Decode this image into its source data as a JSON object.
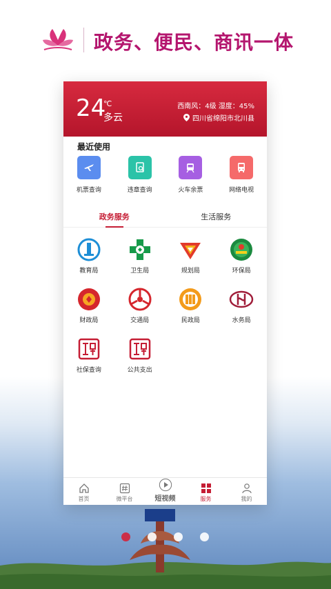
{
  "banner": {
    "slogan": "政务、便民、商讯一体"
  },
  "weather": {
    "temperature": "24",
    "unit": "℃",
    "condition": "多云",
    "wind_humidity": "西南风：4级  湿度：45%",
    "location": "四川省绵阳市北川县"
  },
  "recent": {
    "title": "最近使用",
    "items": [
      {
        "label": "机票查询",
        "icon": "airplane-icon",
        "color": "#5b8def"
      },
      {
        "label": "违章查询",
        "icon": "document-search-icon",
        "color": "#2bc3a8"
      },
      {
        "label": "火车余票",
        "icon": "train-icon",
        "color": "#a65fe2"
      },
      {
        "label": "网络电视",
        "icon": "bus-icon",
        "color": "#f56a6a"
      }
    ]
  },
  "tabs": [
    {
      "label": "政务服务",
      "active": true
    },
    {
      "label": "生活服务",
      "active": false
    }
  ],
  "services": [
    {
      "label": "教育局",
      "icon": "education-bureau-icon"
    },
    {
      "label": "卫生局",
      "icon": "health-bureau-icon"
    },
    {
      "label": "规划局",
      "icon": "planning-bureau-icon"
    },
    {
      "label": "环保局",
      "icon": "environment-bureau-icon"
    },
    {
      "label": "财政局",
      "icon": "finance-bureau-icon"
    },
    {
      "label": "交通局",
      "icon": "transport-bureau-icon"
    },
    {
      "label": "民政局",
      "icon": "civil-affairs-icon"
    },
    {
      "label": "水务局",
      "icon": "water-bureau-icon"
    },
    {
      "label": "社保查询",
      "icon": "social-security-seal-icon"
    },
    {
      "label": "公共支出",
      "icon": "public-expense-seal-icon"
    }
  ],
  "bottom_nav": [
    {
      "label": "首页",
      "icon": "home-icon"
    },
    {
      "label": "微平台",
      "icon": "hashtag-icon"
    },
    {
      "label": "短视频",
      "icon": "play-icon"
    },
    {
      "label": "服务",
      "icon": "grid-icon",
      "active": true
    },
    {
      "label": "我的",
      "icon": "user-icon"
    }
  ],
  "carousel": {
    "count": 4,
    "active_index": 0
  }
}
